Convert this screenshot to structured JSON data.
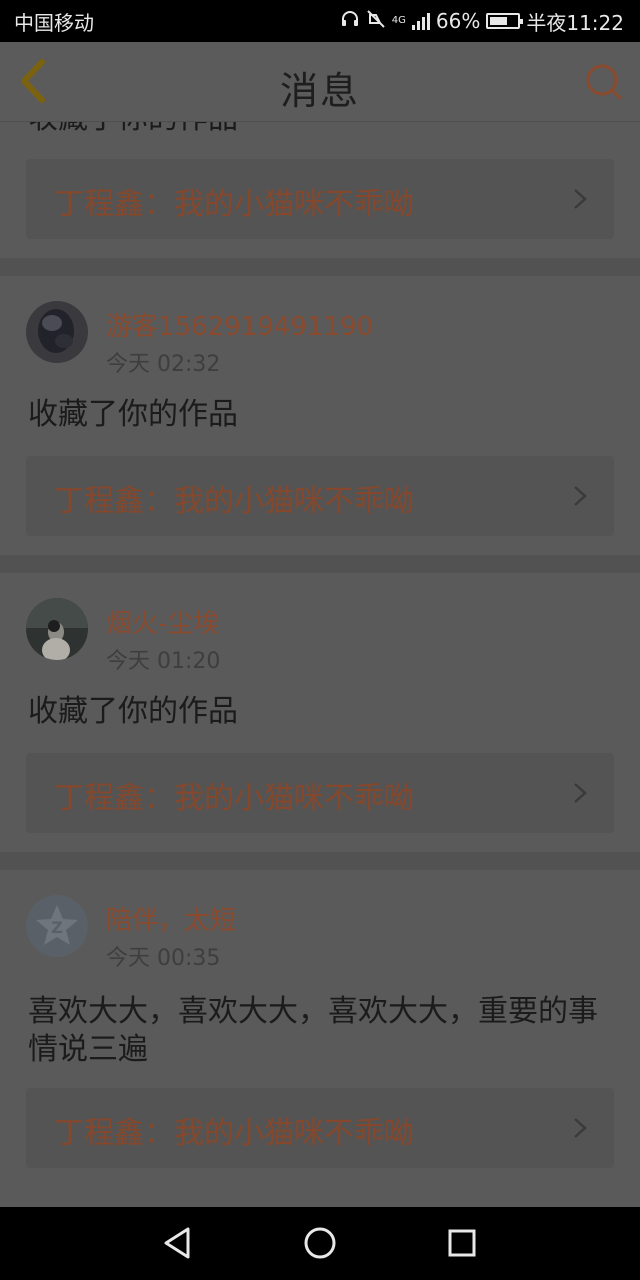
{
  "status_bar": {
    "carrier": "中国移动",
    "network": "4G",
    "battery_percent": "66%",
    "battery_level": 0.66,
    "time": "半夜11:22",
    "icons": [
      "headset-icon",
      "mute-icon",
      "signal-icon",
      "battery-icon"
    ]
  },
  "header": {
    "title": "消息",
    "back_icon": "chevron-left-icon",
    "search_icon": "search-icon"
  },
  "top_partial": {
    "text": "收藏了你的作品",
    "work_title": "丁程鑫：我的小猫咪不乖呦"
  },
  "messages": [
    {
      "username": "游客1562919491190",
      "time": "今天 02:32",
      "text": "收藏了你的作品",
      "work_title": "丁程鑫：我的小猫咪不乖呦"
    },
    {
      "username": "烟火-尘埃",
      "time": "今天 01:20",
      "text": "收藏了你的作品",
      "work_title": "丁程鑫：我的小猫咪不乖呦"
    },
    {
      "username": "陪伴，太短",
      "time": "今天 00:35",
      "text": "喜欢大大，喜欢大大，喜欢大大，重要的事情说三遍",
      "work_title": "丁程鑫：我的小猫咪不乖呦"
    }
  ],
  "nav_bar": {
    "back_icon": "triangle-back-icon",
    "home_icon": "circle-home-icon",
    "recent_icon": "square-recent-icon"
  },
  "colors": {
    "accent": "#8a4a2e",
    "overlay_background": "#5a5a5a",
    "status_bar": "#000000"
  }
}
